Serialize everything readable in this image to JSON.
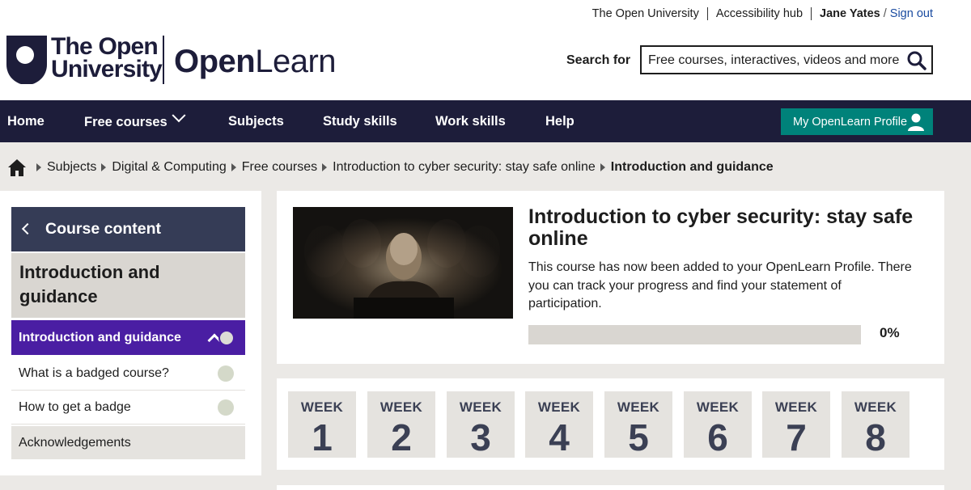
{
  "header": {
    "top_links": [
      "The Open University",
      "Accessibility hub"
    ],
    "user_name": "Jane Yates",
    "separator": "/",
    "sign_out": "Sign out",
    "logo": {
      "ou_line1": "The Open",
      "ou_line2": "University",
      "openlearn_bold": "Open",
      "openlearn_regular": "Learn"
    },
    "search": {
      "label": "Search for",
      "placeholder": "Free courses, interactives, videos and more",
      "icon": "search-icon"
    }
  },
  "nav": {
    "items": [
      "Home",
      "Free courses",
      "Subjects",
      "Study skills",
      "Work skills",
      "Help"
    ],
    "profile_button": "My OpenLearn Profile",
    "colors": {
      "nav_bg": "#1d1d3a",
      "profile_bg": "#00827a"
    }
  },
  "breadcrumb": {
    "home_icon": "home-icon",
    "items": [
      "Subjects",
      "Digital & Computing",
      "Free courses",
      "Introduction to cyber security: stay safe online"
    ],
    "current": "Introduction and guidance"
  },
  "sidebar": {
    "header": "Course content",
    "section_title": "Introduction and guidance",
    "active_item": "Introduction and guidance",
    "items": [
      "What is a badged course?",
      "How to get a badge"
    ],
    "acknowledgements": "Acknowledgements",
    "colors": {
      "active_bg": "#4a1ea3",
      "header_bg": "#353c56"
    }
  },
  "course": {
    "title": "Introduction to cyber security: stay safe online",
    "description": "This course has now been added to your OpenLearn Profile. There you can track your progress and find your statement of participation.",
    "progress_percent": 0,
    "progress_label": "0%"
  },
  "weeks": {
    "label": "WEEK",
    "numbers": [
      "1",
      "2",
      "3",
      "4",
      "5",
      "6",
      "7",
      "8"
    ]
  }
}
